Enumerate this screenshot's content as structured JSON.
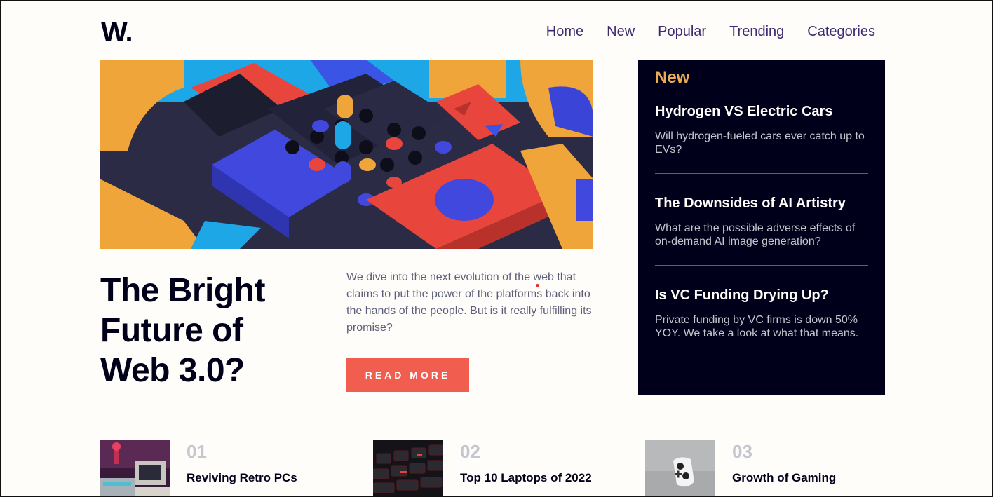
{
  "header": {
    "logo": "W.",
    "nav": [
      "Home",
      "New",
      "Popular",
      "Trending",
      "Categories"
    ]
  },
  "hero": {
    "image_icon": "abstract-blocks-image",
    "title": "The Bright Future of Web 3.0?",
    "description": "We dive into the next evolution of the web that claims to put the power of the platforms back into the hands of the people. But is it really fulfilling its promise?",
    "button": "READ MORE"
  },
  "sidebar": {
    "title": "New",
    "items": [
      {
        "title": "Hydrogen VS Electric Cars",
        "text": "Will hydrogen-fueled cars ever catch up to EVs?"
      },
      {
        "title": "The Downsides of AI Artistry",
        "text": "What are the possible adverse effects of on-demand AI image generation?"
      },
      {
        "title": "Is VC Funding Drying Up?",
        "text": "Private funding by VC firms is down 50% YOY. We take a look at what that means."
      }
    ]
  },
  "articles": [
    {
      "num": "01",
      "title": "Reviving Retro PCs",
      "image_icon": "retro-pc-image"
    },
    {
      "num": "02",
      "title": "Top 10 Laptops of 2022",
      "image_icon": "keyboard-image"
    },
    {
      "num": "03",
      "title": "Growth of Gaming",
      "image_icon": "game-controller-image"
    }
  ],
  "colors": {
    "accent": "#f15e50",
    "dark": "#00001a",
    "nav": "#3e2a73",
    "sidebar_heading": "#e9ab53",
    "background": "#fffdfa"
  }
}
